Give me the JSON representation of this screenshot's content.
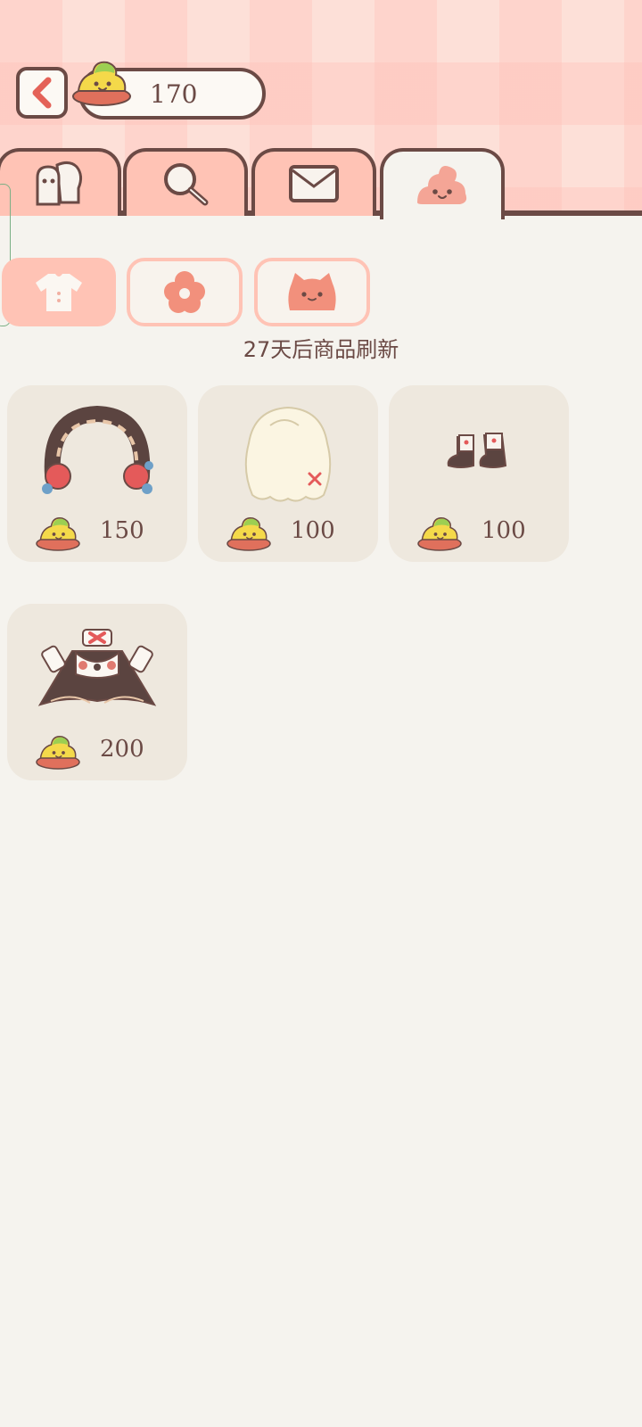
{
  "header": {
    "back_icon": "chevron-left-icon",
    "currency": {
      "icon": "poop-coin-icon",
      "value": "170"
    }
  },
  "tabs": [
    {
      "name": "friends",
      "icon": "friends-icon",
      "active": false
    },
    {
      "name": "search",
      "icon": "magnifier-icon",
      "active": false
    },
    {
      "name": "mail",
      "icon": "envelope-icon",
      "active": false
    },
    {
      "name": "shop",
      "icon": "poop-face-icon",
      "active": true
    }
  ],
  "categories": [
    {
      "name": "clothes",
      "icon": "shirt-icon",
      "active": true
    },
    {
      "name": "flower",
      "icon": "flower-icon",
      "active": false
    },
    {
      "name": "cat",
      "icon": "cat-face-icon",
      "active": false
    }
  ],
  "refresh_notice": "27天后商品刷新",
  "items": [
    {
      "name": "headband",
      "icon": "headband-icon",
      "price": "150"
    },
    {
      "name": "wig",
      "icon": "wig-icon",
      "price": "100"
    },
    {
      "name": "shoes",
      "icon": "shoes-icon",
      "price": "100"
    },
    {
      "name": "outfit",
      "icon": "maid-outfit-icon",
      "price": "200"
    }
  ],
  "colors": {
    "outline": "#6b4a45",
    "tab_pink": "#ffc3b5",
    "card_bg": "#eee8de",
    "page_bg": "#f5f3ee",
    "accent_coral": "#f2907c"
  }
}
